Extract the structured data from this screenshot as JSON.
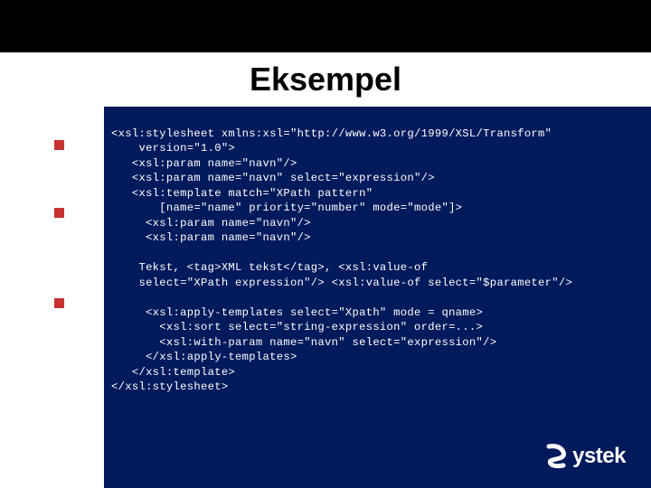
{
  "title": "Eksempel",
  "code": "<xsl:stylesheet xmlns:xsl=\"http://www.w3.org/1999/XSL/Transform\"\n    version=\"1.0\">\n   <xsl:param name=\"navn\"/>\n   <xsl:param name=\"navn\" select=\"expression\"/>\n   <xsl:template match=\"XPath pattern\"\n       [name=\"name\" priority=\"number\" mode=\"mode\"]>\n     <xsl:param name=\"navn\"/>\n     <xsl:param name=\"navn\"/>\n\n    Tekst, <tag>XML tekst</tag>, <xsl:value-of\n    select=\"XPath expression\"/> <xsl:value-of select=\"$parameter\"/>\n\n     <xsl:apply-templates select=\"Xpath\" mode = qname>\n       <xsl:sort select=\"string-expression\" order=...>\n       <xsl:with-param name=\"navn\" select=\"expression\"/>\n     </xsl:apply-templates>\n   </xsl:template>\n</xsl:stylesheet>",
  "logo_text": "ystek",
  "colors": {
    "background": "#001a5c",
    "bullet": "#c83232",
    "panel": "#ffffff"
  }
}
